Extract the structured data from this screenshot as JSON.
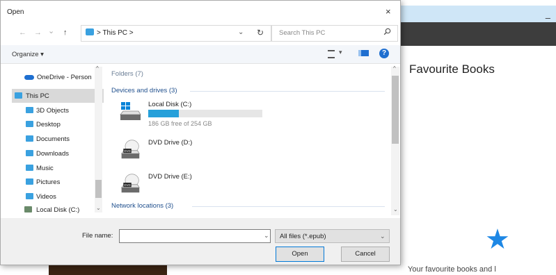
{
  "background": {
    "minimize_label": "–",
    "page_title": "Favourite Books",
    "star_glyph": "★",
    "footer_text": "Your favourite books and l"
  },
  "dialog": {
    "title": "Open",
    "close_glyph": "×",
    "nav": {
      "back": "←",
      "forward": "→",
      "recent": "⌄",
      "up": "↑"
    },
    "address": {
      "path": "> This PC >",
      "chevron": "⌄"
    },
    "refresh_glyph": "↻",
    "search": {
      "placeholder": "Search This PC",
      "icon": "search-icon"
    },
    "toolbar": {
      "organize_label": "Organize ▾",
      "view_dropdown": "▾",
      "help_label": "?"
    },
    "sidebar": {
      "items": [
        {
          "label": "OneDrive - Person",
          "icon": "cloud-icon",
          "color": "#1e6fd0"
        },
        {
          "label": "This PC",
          "icon": "computer-icon",
          "color": "#3aa1e0",
          "selected": true
        },
        {
          "label": "3D Objects",
          "icon": "cube-icon",
          "color": "#3aa1e0"
        },
        {
          "label": "Desktop",
          "icon": "folder-icon",
          "color": "#3aa1e0"
        },
        {
          "label": "Documents",
          "icon": "folder-icon",
          "color": "#3aa1e0"
        },
        {
          "label": "Downloads",
          "icon": "folder-icon",
          "color": "#3aa1e0"
        },
        {
          "label": "Music",
          "icon": "folder-icon",
          "color": "#3aa1e0"
        },
        {
          "label": "Pictures",
          "icon": "folder-icon",
          "color": "#3aa1e0"
        },
        {
          "label": "Videos",
          "icon": "folder-icon",
          "color": "#3aa1e0"
        },
        {
          "label": "Local Disk (C:)",
          "icon": "drive-icon",
          "color": "#6a8a6a"
        }
      ]
    },
    "content": {
      "groups": {
        "folders": "Folders (7)",
        "devices": "Devices and drives (3)",
        "network": "Network locations (3)"
      },
      "drives": [
        {
          "name": "Local Disk (C:)",
          "free": "186 GB free of 254 GB",
          "used_fraction": 0.27
        },
        {
          "name": "DVD Drive (D:)"
        },
        {
          "name": "DVD Drive (E:)"
        }
      ],
      "dvd_badge": "DVD"
    },
    "footer": {
      "file_name_label": "File name:",
      "file_name_value": "",
      "file_type": "All files (*.epub)",
      "open_label": "Open",
      "cancel_label": "Cancel"
    }
  }
}
